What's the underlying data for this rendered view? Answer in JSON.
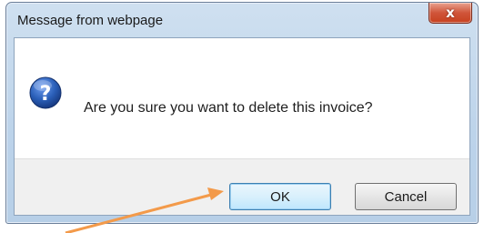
{
  "dialog": {
    "title": "Message from webpage",
    "close_symbol": "x",
    "icon": "question-icon",
    "message": "Are you sure you want to delete this invoice?",
    "ok_label": "OK",
    "cancel_label": "Cancel"
  },
  "colors": {
    "titlebar": "#bcd3ea",
    "close_button": "#d0553a",
    "question_icon": "#2a5fb8",
    "annotation_arrow": "#f39a4a"
  }
}
